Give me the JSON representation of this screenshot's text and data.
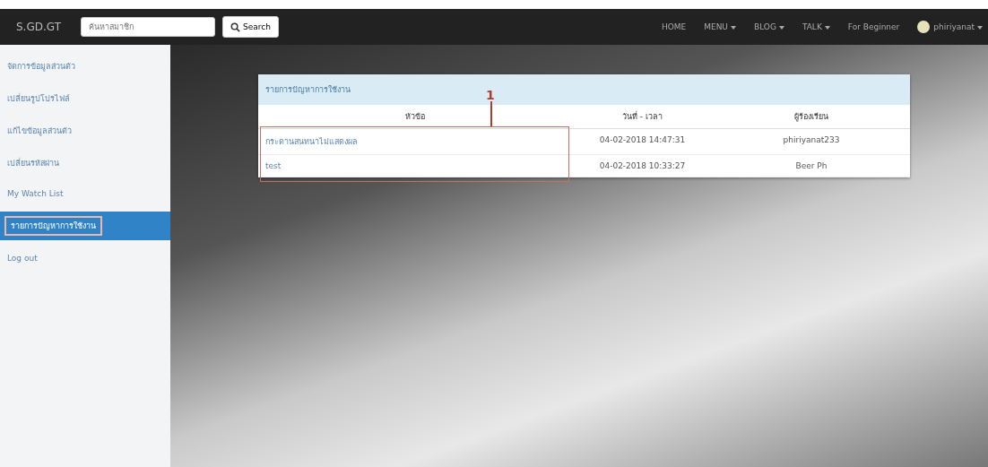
{
  "navbar": {
    "brand": "S.GD.GT",
    "search": {
      "placeholder": "ค้นหาสมาชิก"
    },
    "search_button": "Search",
    "links": [
      {
        "label": "HOME",
        "dropdown": false
      },
      {
        "label": "MENU",
        "dropdown": true
      },
      {
        "label": "BLOG",
        "dropdown": true
      },
      {
        "label": "TALK",
        "dropdown": true
      },
      {
        "label": "For Beginner",
        "dropdown": false
      }
    ],
    "user": {
      "name": "phiriyanat",
      "dropdown": true
    }
  },
  "sidebar": {
    "items": [
      {
        "label": "จัดการข้อมูลส่วนตัว",
        "selected": false
      },
      {
        "label": "เปลี่ยนรูปโปรไฟล์",
        "selected": false
      },
      {
        "label": "แก้ไขข้อมูลส่วนตัว",
        "selected": false
      },
      {
        "label": "เปลี่ยนรหัสผ่าน",
        "selected": false
      },
      {
        "label": "My Watch List",
        "selected": false
      },
      {
        "label": "รายการปัญหาการใช้งาน",
        "selected": true
      },
      {
        "label": "Log out",
        "selected": false
      }
    ]
  },
  "panel": {
    "title": "รายการปัญหาการใช้งาน",
    "columns": [
      "หัวข้อ",
      "วันที่ - เวลา",
      "ผู้ร้องเรียน"
    ],
    "rows": [
      [
        "กระดานสนทนาไม่แสดงผล",
        "04-02-2018 14:47:31",
        "phiriyanat233"
      ],
      [
        "test",
        "04-02-2018 10:33:27",
        "Beer Ph"
      ]
    ],
    "annotation": "1"
  }
}
